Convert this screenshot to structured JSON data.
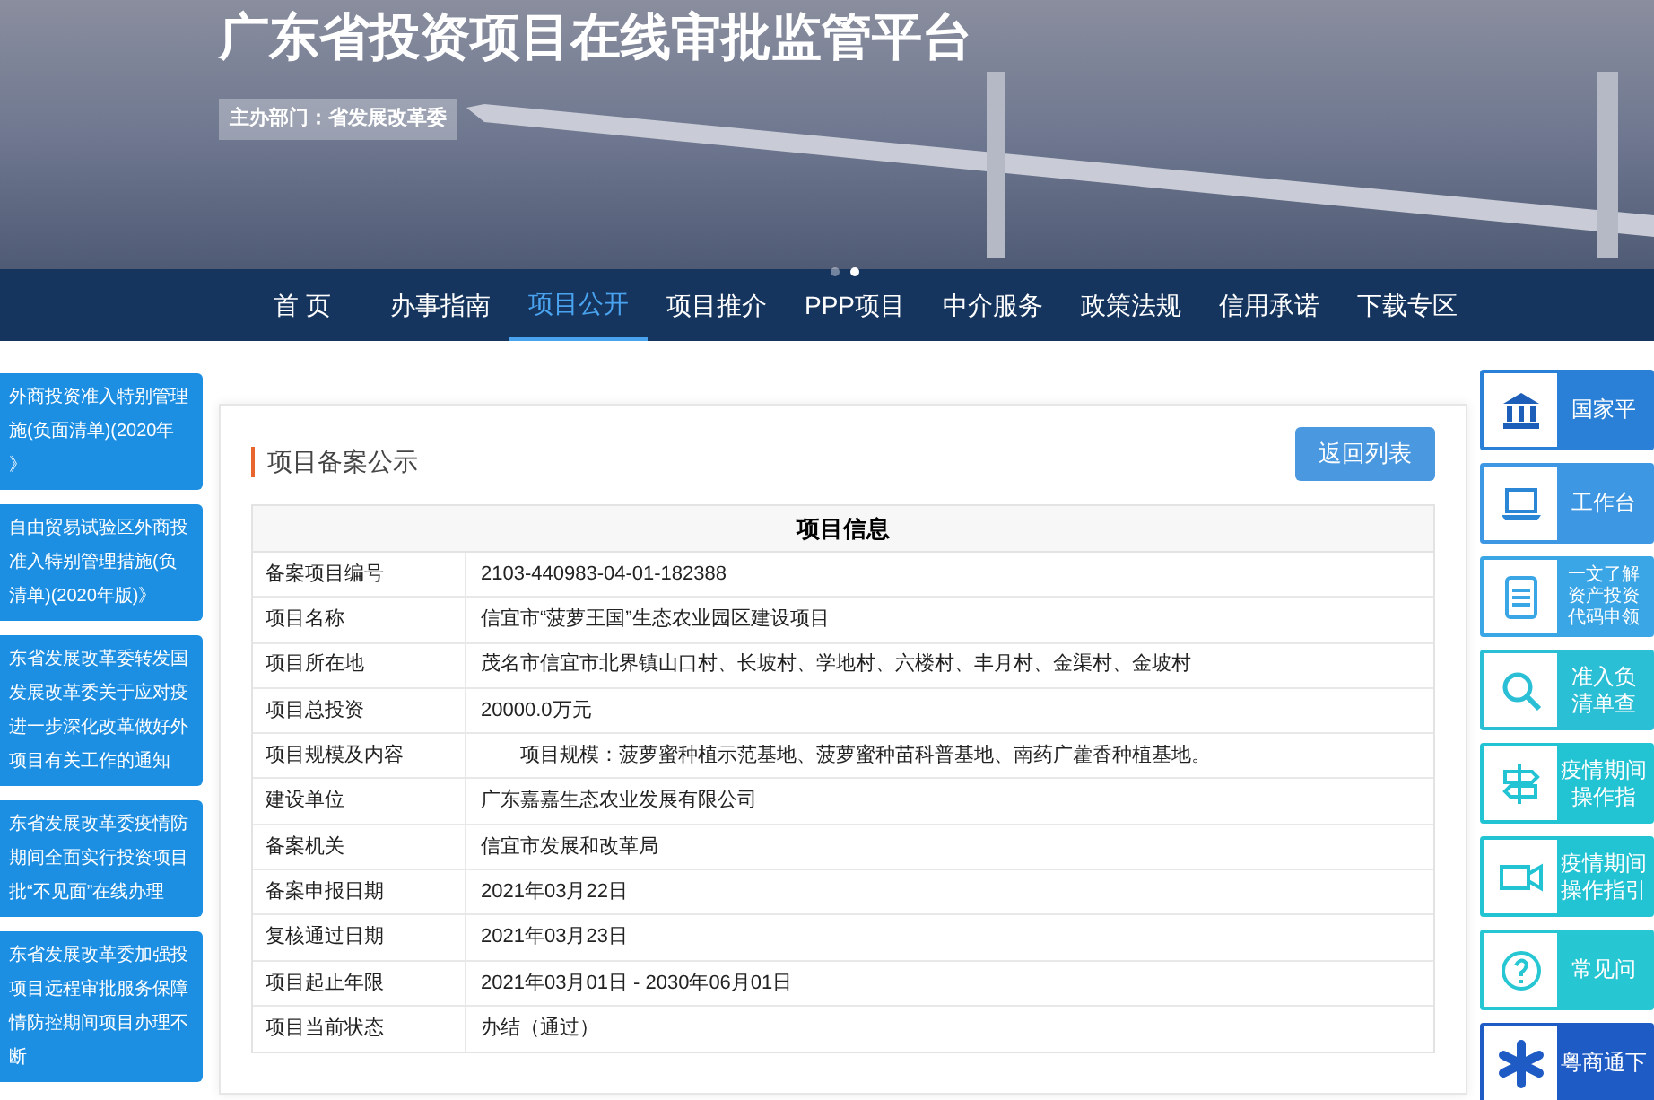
{
  "header": {
    "title": "广东省投资项目在线审批监管平台",
    "sponsor": "主办部门：省发展改革委",
    "carousel_dots": [
      {
        "selected": false
      },
      {
        "selected": true
      }
    ]
  },
  "nav": [
    {
      "label": "首 页",
      "selected": false
    },
    {
      "label": "办事指南",
      "selected": false
    },
    {
      "label": "项目公开",
      "selected": true
    },
    {
      "label": "项目推介",
      "selected": false
    },
    {
      "label": "PPP项目",
      "selected": false
    },
    {
      "label": "中介服务",
      "selected": false
    },
    {
      "label": "政策法规",
      "selected": false
    },
    {
      "label": "信用承诺",
      "selected": false
    },
    {
      "label": "下载专区",
      "selected": false
    }
  ],
  "left_links": [
    {
      "lines": [
        "外商投资准入特别管理",
        "施(负面清单)(2020年",
        "》"
      ]
    },
    {
      "lines": [
        "自由贸易试验区外商投",
        "准入特别管理措施(负",
        "清单)(2020年版)》"
      ]
    },
    {
      "lines": [
        "东省发展改革委转发国",
        "发展改革委关于应对疫",
        "进一步深化改革做好外",
        "项目有关工作的通知"
      ]
    },
    {
      "lines": [
        "东省发展改革委疫情防",
        "期间全面实行投资项目",
        "批“不见面”在线办理"
      ]
    },
    {
      "lines": [
        "东省发展改革委加强投",
        "项目远程审批服务保障",
        "情防控期间项目办理不",
        "断"
      ]
    }
  ],
  "main": {
    "title": "项目备案公示",
    "back_button": "返回列表",
    "table_title": "项目信息",
    "rows": [
      {
        "label": "备案项目编号",
        "value": "2103-440983-04-01-182388"
      },
      {
        "label": "项目名称",
        "value": "信宜市“菠萝王国”生态农业园区建设项目"
      },
      {
        "label": "项目所在地",
        "value": "茂名市信宜市北界镇山口村、长坡村、学地村、六楼村、丰月村、金渠村、金坡村"
      },
      {
        "label": "项目总投资",
        "value": "20000.0万元"
      },
      {
        "label": "项目规模及内容",
        "value": "　　项目规模：菠萝蜜种植示范基地、菠萝蜜种苗科普基地、南药广藿香种植基地。"
      },
      {
        "label": "建设单位",
        "value": "广东嘉嘉生态农业发展有限公司"
      },
      {
        "label": "备案机关",
        "value": "信宜市发展和改革局"
      },
      {
        "label": "备案申报日期",
        "value": "2021年03月22日"
      },
      {
        "label": "复核通过日期",
        "value": "2021年03月23日"
      },
      {
        "label": "项目起止年限",
        "value": "2021年03月01日 - 2030年06月01日"
      },
      {
        "label": "项目当前状态",
        "value": "办结（通过）"
      }
    ]
  },
  "right_links": [
    {
      "kind": "bank",
      "lines": [
        "国家平"
      ],
      "color": "#2a80d6"
    },
    {
      "kind": "laptop",
      "lines": [
        "工作台"
      ],
      "color": "#3d97e3"
    },
    {
      "kind": "document",
      "lines": [
        "一文了解",
        "资产投资",
        "代码申领"
      ],
      "color": "#3aa6e6"
    },
    {
      "kind": "search",
      "lines": [
        "准入负",
        "清单查"
      ],
      "color": "#2bbfd6"
    },
    {
      "kind": "signpost",
      "lines": [
        "疫情期间",
        "操作指"
      ],
      "color": "#22c3d3"
    },
    {
      "kind": "video",
      "lines": [
        "疫情期间",
        "操作指引"
      ],
      "color": "#22c3d3"
    },
    {
      "kind": "question",
      "lines": [
        "常见问"
      ],
      "color": "#26c6d3"
    },
    {
      "kind": "star",
      "lines": [
        "粤商通下"
      ],
      "color": "#1f5bc4"
    }
  ]
}
